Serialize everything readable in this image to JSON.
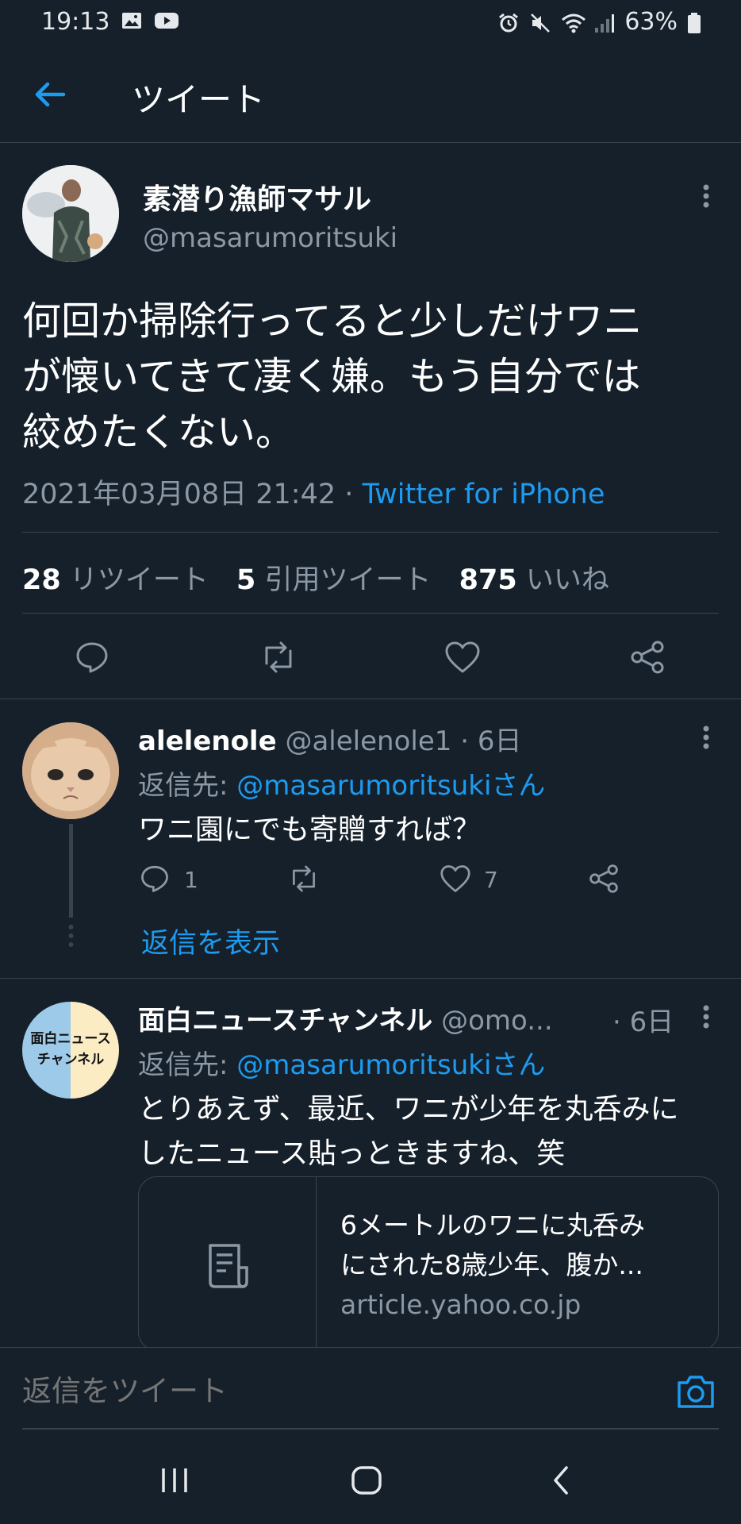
{
  "status_bar": {
    "time": "19:13",
    "battery": "63%"
  },
  "header": {
    "title": "ツイート"
  },
  "tweet": {
    "author_name": "素潜り漁師マサル",
    "author_handle": "@masarumoritsuki",
    "text_lines": [
      "何回か掃除行ってると少しだけワニ",
      "が懐いてきて凄く嫌。もう自分では",
      "絞めたくない。"
    ],
    "timestamp": "2021年03月08日 21:42",
    "separator": "·",
    "source": "Twitter for iPhone",
    "stats": {
      "retweets_count": "28",
      "retweets_label": "リツイート",
      "quotes_count": "5",
      "quotes_label": "引用ツイート",
      "likes_count": "875",
      "likes_label": "いいね"
    }
  },
  "replies": [
    {
      "author_name": "alelenole",
      "author_handle": "@alelenole1",
      "age": "· 6日",
      "reply_to_label": "返信先:",
      "reply_to": "@masarumoritsukiさん",
      "text": "ワニ園にでも寄贈すれば？",
      "reply_count": "1",
      "like_count": "7",
      "show_replies": "返信を表示"
    },
    {
      "author_name": "面白ニュースチャンネル",
      "author_handle": "@omo...",
      "age": "· 6日",
      "avatar_text_1": "面白ニュース",
      "avatar_text_2": "チャンネル",
      "reply_to_label": "返信先:",
      "reply_to": "@masarumoritsukiさん",
      "text_lines": [
        "とりあえず、最近、ワニが少年を丸呑みに",
        "したニュース貼っときますね、笑"
      ],
      "card": {
        "title_lines": [
          "6メートルのワニに丸呑み",
          "にされた8歳少年、腹か..."
        ],
        "domain": "article.yahoo.co.jp"
      }
    }
  ],
  "compose": {
    "placeholder": "返信をツイート"
  },
  "colors": {
    "background": "#15202b",
    "accent": "#1d9bf0",
    "muted": "#8b98a5",
    "border": "#38444d"
  }
}
